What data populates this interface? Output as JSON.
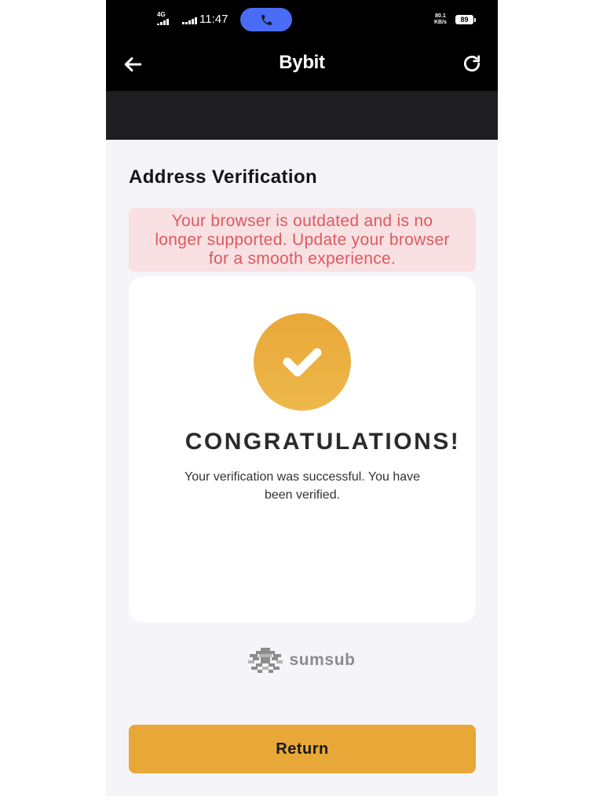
{
  "status_bar": {
    "network": "4G",
    "time": "11:47",
    "speed_value": "80.1",
    "speed_unit": "KB/s",
    "battery": "89"
  },
  "header": {
    "title": "Bybit"
  },
  "main": {
    "heading": "Address Verification",
    "alert": "Your browser is outdated and is no longer supported. Update your browser for a smooth experience.",
    "success": {
      "title": "CONGRATULATIONS!",
      "message": "Your verification was successful. You have been verified."
    },
    "brand": "sumsub",
    "return_label": "Return"
  },
  "icons": {
    "back": "back-arrow-icon",
    "refresh": "refresh-icon",
    "call": "phone-icon",
    "signal": "signal-icon",
    "battery": "battery-icon",
    "success": "check-icon",
    "brand": "sumsub-logo-icon"
  },
  "colors": {
    "accent": "#E8A838",
    "alert_background": "#F9E0E2",
    "alert_text": "#DC5A5F",
    "call_pill": "#4A6CF4",
    "page_background": "#F5F5F9"
  }
}
